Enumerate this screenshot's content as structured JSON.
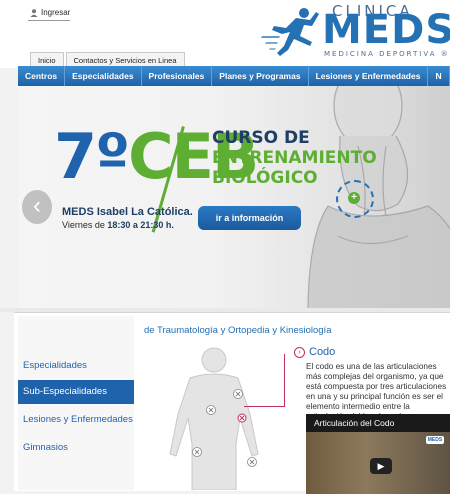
{
  "header": {
    "login_label": "Ingresar",
    "logo": {
      "clinica": "CLINICA",
      "meds": "MEDS",
      "subtitle": "MEDICINA DEPORTIVA ®"
    },
    "tabs": [
      "Inicio",
      "Contactos y Servicios en Linea"
    ]
  },
  "nav": {
    "items": [
      "Centros",
      "Especialidades",
      "Profesionales",
      "Planes y Programas",
      "Lesiones y Enfermedades",
      "N"
    ]
  },
  "hero": {
    "number": "7º",
    "acronym": "CEB",
    "course_line1": "CURSO DE",
    "course_line2": "ENTRENAMIENTO",
    "course_line3": "BIOLÓGICO",
    "place": "MEDS Isabel La Católica.",
    "time_prefix": "Viernes de ",
    "time_value": "18:30 a 21:30 h.",
    "button_label": "ir a información"
  },
  "sidebar": {
    "items": [
      "Especialidades",
      "Sub-Especialidades",
      "Lesiones y Enfermedades",
      "Gimnasios"
    ],
    "active_index": 1
  },
  "content": {
    "section_title": "de Traumatología y Ortopedia y Kinesiología",
    "topic_title": "Codo",
    "topic_description": "El codo es una de las articulaciones más complejas del organismo, ya que está compuesta por tres articulaciones en una y su principal función es ser el elemento intermedio entre la articulación del hombro y la mano...",
    "video_title": "Articulación del Codo",
    "video_badge": "MEDS"
  },
  "colors": {
    "brand_blue": "#1f63ad",
    "brand_green": "#5dae32",
    "accent_pink": "#c22f5a"
  }
}
